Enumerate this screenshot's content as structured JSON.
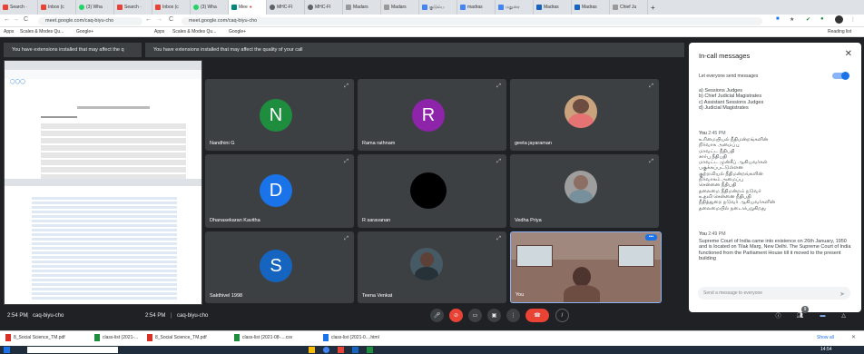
{
  "browser": {
    "tabs": [
      {
        "label": "Search ·"
      },
      {
        "label": "Inbox (c"
      },
      {
        "label": "(3) Wha"
      },
      {
        "label": "Search ·"
      },
      {
        "label": "Inbox (c"
      },
      {
        "label": "(3) Wha"
      },
      {
        "label": "Mee"
      },
      {
        "label": "MHC-FI"
      },
      {
        "label": "MHC-FI"
      },
      {
        "label": "Madars"
      },
      {
        "label": "Madars"
      },
      {
        "label": "குடும்ப"
      },
      {
        "label": "madras"
      },
      {
        "label": "மதுரை"
      },
      {
        "label": "Madras"
      },
      {
        "label": "Madras"
      },
      {
        "label": "Chief Ju"
      }
    ],
    "url_left": "meet.google.com/caq-biyu-cho",
    "url_right": "meet.google.com/caq-biyu-cho",
    "bookmarks": {
      "apps_left": "Apps",
      "scales_left": "Scales & Modes Qu...",
      "google_left": "Google+",
      "apps_right": "Apps",
      "scales_right": "Scales & Modes Qu...",
      "google_right": "Google+",
      "reading_list": "Reading list"
    }
  },
  "meet": {
    "banner_left": "You have extensions installed that may affect the q",
    "banner_right": "You have extensions installed that may affect the quality of your call",
    "participants": [
      {
        "name": "Nandhini G",
        "initial": "N",
        "color": "#1e8e3e"
      },
      {
        "name": "Rama rathnam",
        "initial": "R",
        "color": "#8e24aa"
      },
      {
        "name": "geeta jayaraman",
        "initial": "",
        "color": ""
      },
      {
        "name": "Dhanasekaran Kavitha",
        "initial": "D",
        "color": "#1a73e8"
      },
      {
        "name": "R saravanan",
        "initial": "",
        "color": "#000000"
      },
      {
        "name": "Vedha Priya",
        "initial": "",
        "color": ""
      },
      {
        "name": "Sakthivel 1998",
        "initial": "S",
        "color": "#1565c0"
      },
      {
        "name": "Teena Venkat",
        "initial": "",
        "color": ""
      },
      {
        "name": "You",
        "initial": "",
        "color": ""
      }
    ],
    "time_left": "2:54 PM",
    "code_left": "caq-biyu-cho",
    "time_right": "2:54 PM",
    "code_right": "caq-biyu-cho",
    "participant_count": "9"
  },
  "chat": {
    "title": "In-call messages",
    "permission": "Let everyone send messages",
    "options_text": "a) Sessions Judges\nb) Chief Judicial Magistrates\nc) Assistant Sessions Judges\nd) Judicial Magistrates",
    "msg1_sender": "You",
    "msg1_time": "2:45 PM",
    "msg1_text": "உரிமையியல் நீதிமன்றங்களின்\nநிர்வாக அமைப்பு\nமாவட்ட நீதிபதி\nசார்பு நீதிபதி\nமாவட்ட முன்சீப் ஆகியவர்கள்\nபகுக்கப்பட்டுள்ளன\nகுற்றவியல் நீதிமன்றங்களின்\nநிர்வாகம் அமைப்பு\nசென்னை நீதிபதி\nதலைமை நீதிமன்றம் நடுவர்\nஉதவி சென்னை நீதிபதி\nநீதித்துறை நடுவர் ஆகியவர்களின்\nதலைமையில் நடைபெறுகிறது",
    "msg2_sender": "You",
    "msg2_time": "2:49 PM",
    "msg2_text": "Supreme Court of India came into existence on 26th January, 1950 and is located on Tilak Marg, New Delhi. The Supreme Court of India functioned from the Parliament House till it moved to the present building",
    "input_placeholder": "Send a message to everyone"
  },
  "downloads": [
    {
      "label": "8_Social Science_TM.pdf"
    },
    {
      "label": "class-list (2021-..."
    },
    {
      "label": "8_Social Science_TM.pdf"
    },
    {
      "label": "class-list (2021-08-....csv"
    },
    {
      "label": "class-list (2021-0....html"
    }
  ],
  "show_all": "Show all",
  "clock": "14:54"
}
